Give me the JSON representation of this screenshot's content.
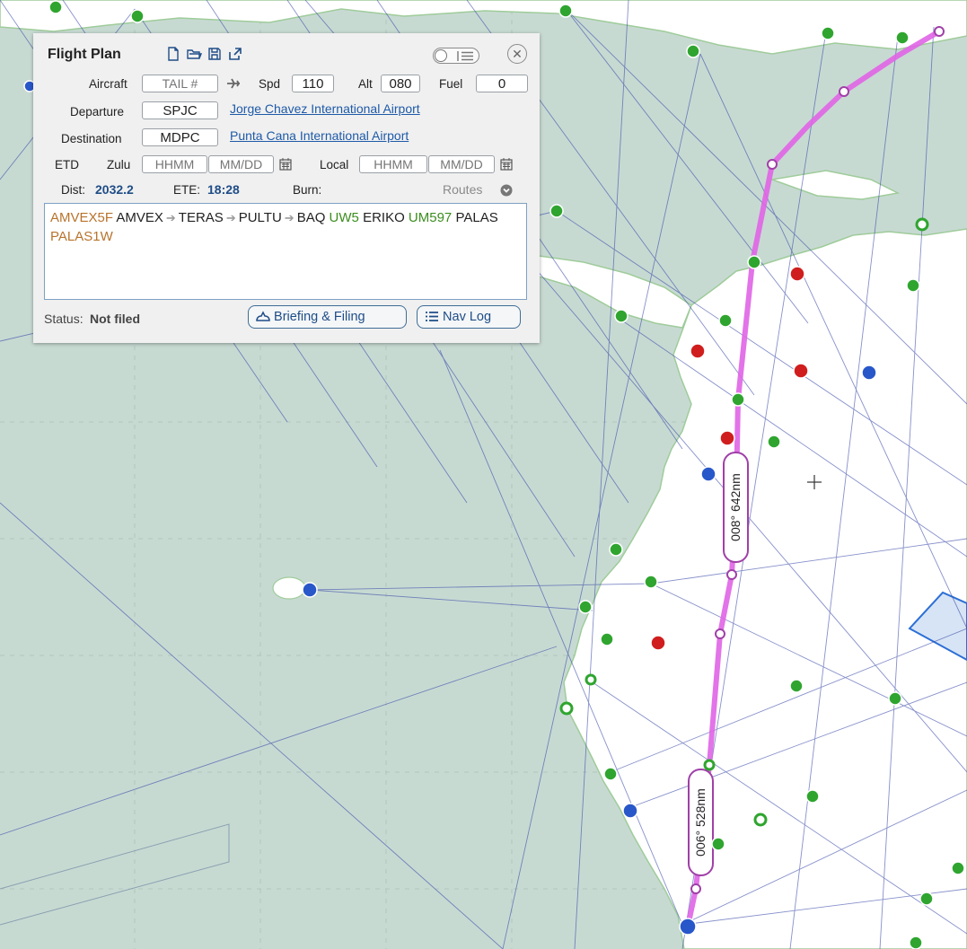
{
  "panel": {
    "title": "Flight Plan",
    "aircraft_label": "Aircraft",
    "aircraft_placeholder": "TAIL #",
    "spd_label": "Spd",
    "spd_value": "110",
    "alt_label": "Alt",
    "alt_value": "080",
    "fuel_label": "Fuel",
    "fuel_value": "0",
    "departure_label": "Departure",
    "departure_code": "SPJC",
    "departure_name": "Jorge Chavez International Airport",
    "destination_label": "Destination",
    "destination_code": "MDPC",
    "destination_name": "Punta Cana International Airport",
    "etd_label": "ETD",
    "zulu_label": "Zulu",
    "local_label": "Local",
    "time_placeholder": "HHMM",
    "date_placeholder": "MM/DD",
    "dist_label": "Dist:",
    "dist_value": "2032.2",
    "ete_label": "ETE:",
    "ete_value": "18:28",
    "burn_label": "Burn:",
    "routes_label": "Routes",
    "route": {
      "departure_proc": "AMVEX5F",
      "fix1": "AMVEX",
      "fix2": "TERAS",
      "fix3": "PULTU",
      "fix4": "BAQ",
      "airway1": "UW5",
      "fix5": "ERIKO",
      "airway2": "UM597",
      "fix6": "PALAS",
      "arrival_proc": "PALAS1W"
    },
    "status_label": "Status:",
    "status_value": "Not filed",
    "briefing_button": "Briefing & Filing",
    "navlog_button": "Nav Log"
  },
  "map": {
    "leg_labels": [
      "008° 642nm",
      "006° 528nm"
    ],
    "route_color": "#e064e6",
    "water_color": "#c7dad2",
    "land_color": "#ffffff",
    "airway_color": "#3848a8"
  }
}
